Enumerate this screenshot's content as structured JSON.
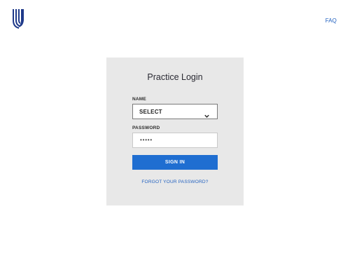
{
  "header": {
    "logo_icon": "uhc-shield-logo-icon",
    "faq_label": "FAQ"
  },
  "login": {
    "title": "Practice Login",
    "name_label": "NAME",
    "name_select_value": "SELECT",
    "password_label": "PASSWORD",
    "password_value": "•••••",
    "signin_label": "SIGN IN",
    "forgot_label": "FORGOT YOUR PASSWORD?"
  },
  "colors": {
    "brand_blue": "#1f6ed1",
    "link_blue": "#1f5fbf",
    "logo_navy": "#1f3a8a",
    "card_bg": "#e8e8e8"
  }
}
